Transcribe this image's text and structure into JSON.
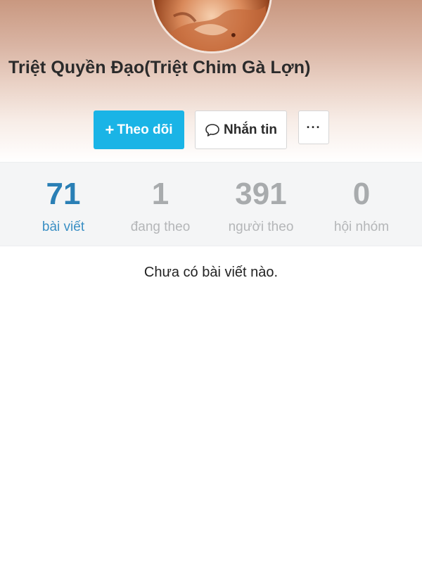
{
  "profile": {
    "name": "Triệt Quyền Đạo(Triệt Chim Gà Lợn)"
  },
  "actions": {
    "follow_icon": "+",
    "follow_label": "Theo dõi",
    "message_label": "Nhắn tin",
    "message_icon": "speech-bubble-icon",
    "more_label": "···"
  },
  "stats": [
    {
      "value": "71",
      "label": "bài viết"
    },
    {
      "value": "1",
      "label": "đang theo"
    },
    {
      "value": "391",
      "label": "người theo"
    },
    {
      "value": "0",
      "label": "hội nhóm"
    }
  ],
  "colors": {
    "accent": "#1ab4e6",
    "active_stat": "#2a7fb5"
  },
  "empty_message": "Chưa có bài viết nào."
}
